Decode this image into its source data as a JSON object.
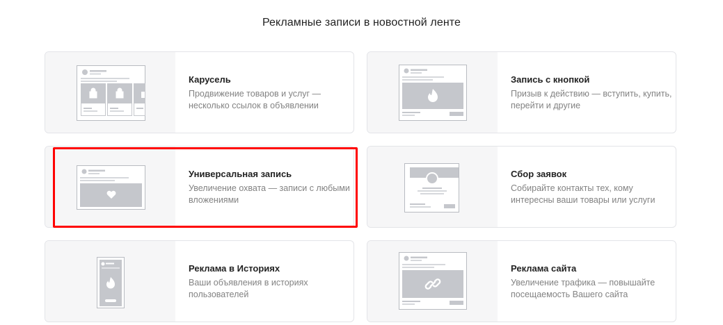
{
  "header": {
    "title": "Рекламные записи в новостной ленте"
  },
  "formats": [
    {
      "id": "carousel",
      "name": "Карусель",
      "description": "Продвижение товаров и услуг — несколько ссылок в объявлении",
      "icon": "carousel-preview-icon"
    },
    {
      "id": "button",
      "name": "Запись с кнопкой",
      "description": "Призыв к действию — вступить, купить, перейти и другие",
      "icon": "button-post-preview-icon"
    },
    {
      "id": "universal",
      "name": "Универсальная запись",
      "description": "Увеличение охвата — записи с любыми вложениями",
      "icon": "universal-post-preview-icon",
      "highlighted": true
    },
    {
      "id": "leads",
      "name": "Сбор заявок",
      "description": "Собирайте контакты тех, кому интересны ваши товары или услуги",
      "icon": "lead-form-preview-icon"
    },
    {
      "id": "stories",
      "name": "Реклама в Историях",
      "description": "Ваши объявления в историях пользователей",
      "icon": "stories-preview-icon"
    },
    {
      "id": "site",
      "name": "Реклама сайта",
      "description": "Увеличение трафика — повышайте посещаемость Вашего сайта",
      "icon": "site-ad-preview-icon"
    }
  ],
  "colors": {
    "highlight": "#ff0000",
    "mock_fill": "#c5c7cc",
    "mock_border": "#b8bbc1"
  }
}
